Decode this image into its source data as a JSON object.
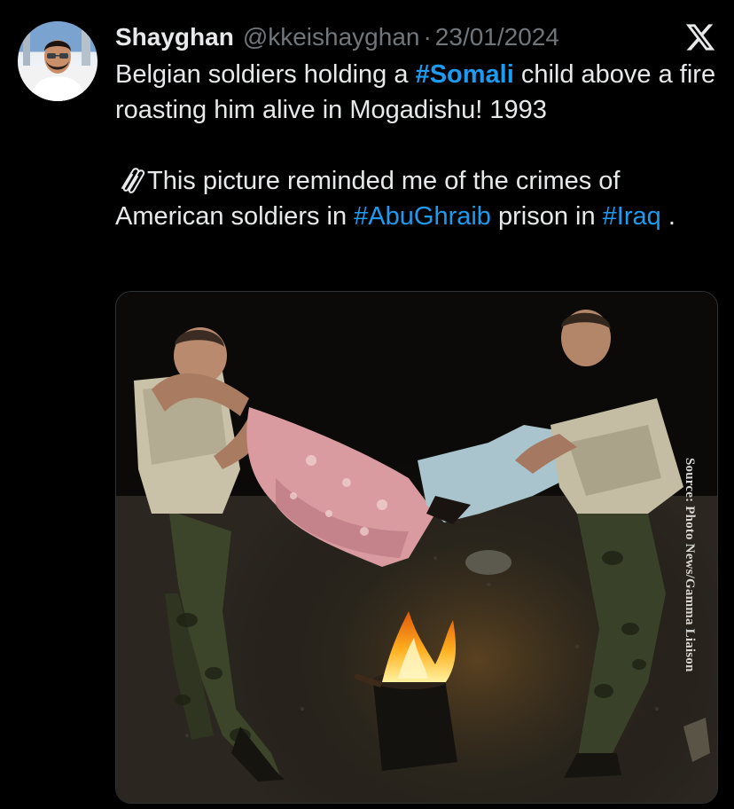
{
  "tweet": {
    "author": {
      "display_name": "Shayghan",
      "handle": "@kkeishayghan",
      "separator": "·",
      "date": "23/01/2024"
    },
    "platform_icon": "x-logo-icon",
    "body": {
      "line1_before": "Belgian soldiers holding a ",
      "hashtag1": "#Somali",
      "line1_after": " child above a fire roasting him alive in Mogadishu! 1993",
      "para2_icon": "paperclip-icon",
      "para2_before": "This picture reminded me of the crimes of American soldiers in ",
      "hashtag2": "#AbuGhraib",
      "para2_middle": " prison in ",
      "hashtag3": "#Iraq",
      "para2_after": " ."
    },
    "media": {
      "watermark": "Source: Photo News/Gamma Liaison"
    }
  },
  "colors": {
    "background": "#000000",
    "text": "#e7e9ea",
    "muted": "#71767b",
    "link": "#1d9bf0"
  }
}
